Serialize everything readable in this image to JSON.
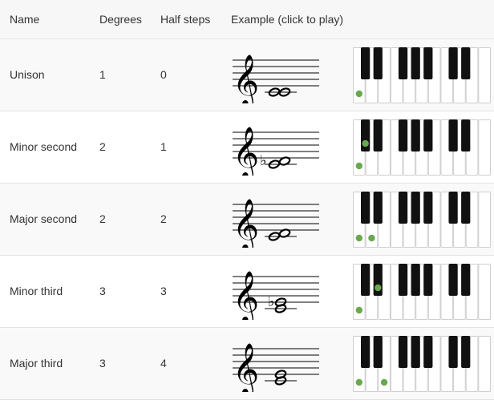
{
  "columns": {
    "name": "Name",
    "degrees": "Degrees",
    "half_steps": "Half steps",
    "example": "Example (click to play)"
  },
  "rows": [
    {
      "name": "Unison",
      "degrees": "1",
      "half_steps": "0",
      "staff": {
        "accidental": "",
        "notes": [
          0,
          0
        ],
        "chord": false
      },
      "keys": {
        "white": [
          0
        ],
        "black": []
      }
    },
    {
      "name": "Minor second",
      "degrees": "2",
      "half_steps": "1",
      "staff": {
        "accidental": "flat",
        "notes": [
          0,
          1
        ],
        "chord": false
      },
      "keys": {
        "white": [
          0
        ],
        "black": [
          0
        ]
      }
    },
    {
      "name": "Major second",
      "degrees": "2",
      "half_steps": "2",
      "staff": {
        "accidental": "",
        "notes": [
          0,
          1
        ],
        "chord": false
      },
      "keys": {
        "white": [
          0,
          1
        ],
        "black": []
      }
    },
    {
      "name": "Minor third",
      "degrees": "3",
      "half_steps": "3",
      "staff": {
        "accidental": "flat",
        "notes": [
          0,
          2
        ],
        "chord": true
      },
      "keys": {
        "white": [
          0
        ],
        "black": [
          1
        ]
      }
    },
    {
      "name": "Major third",
      "degrees": "3",
      "half_steps": "4",
      "staff": {
        "accidental": "",
        "notes": [
          0,
          2
        ],
        "chord": true
      },
      "keys": {
        "white": [
          0,
          2
        ],
        "black": []
      }
    }
  ],
  "colors": {
    "dot": "#6aa84f",
    "black_key": "#111111",
    "white_key": "#ffffff"
  },
  "icons": {
    "clef": "treble-clef-icon",
    "flat": "flat-sign-icon"
  }
}
